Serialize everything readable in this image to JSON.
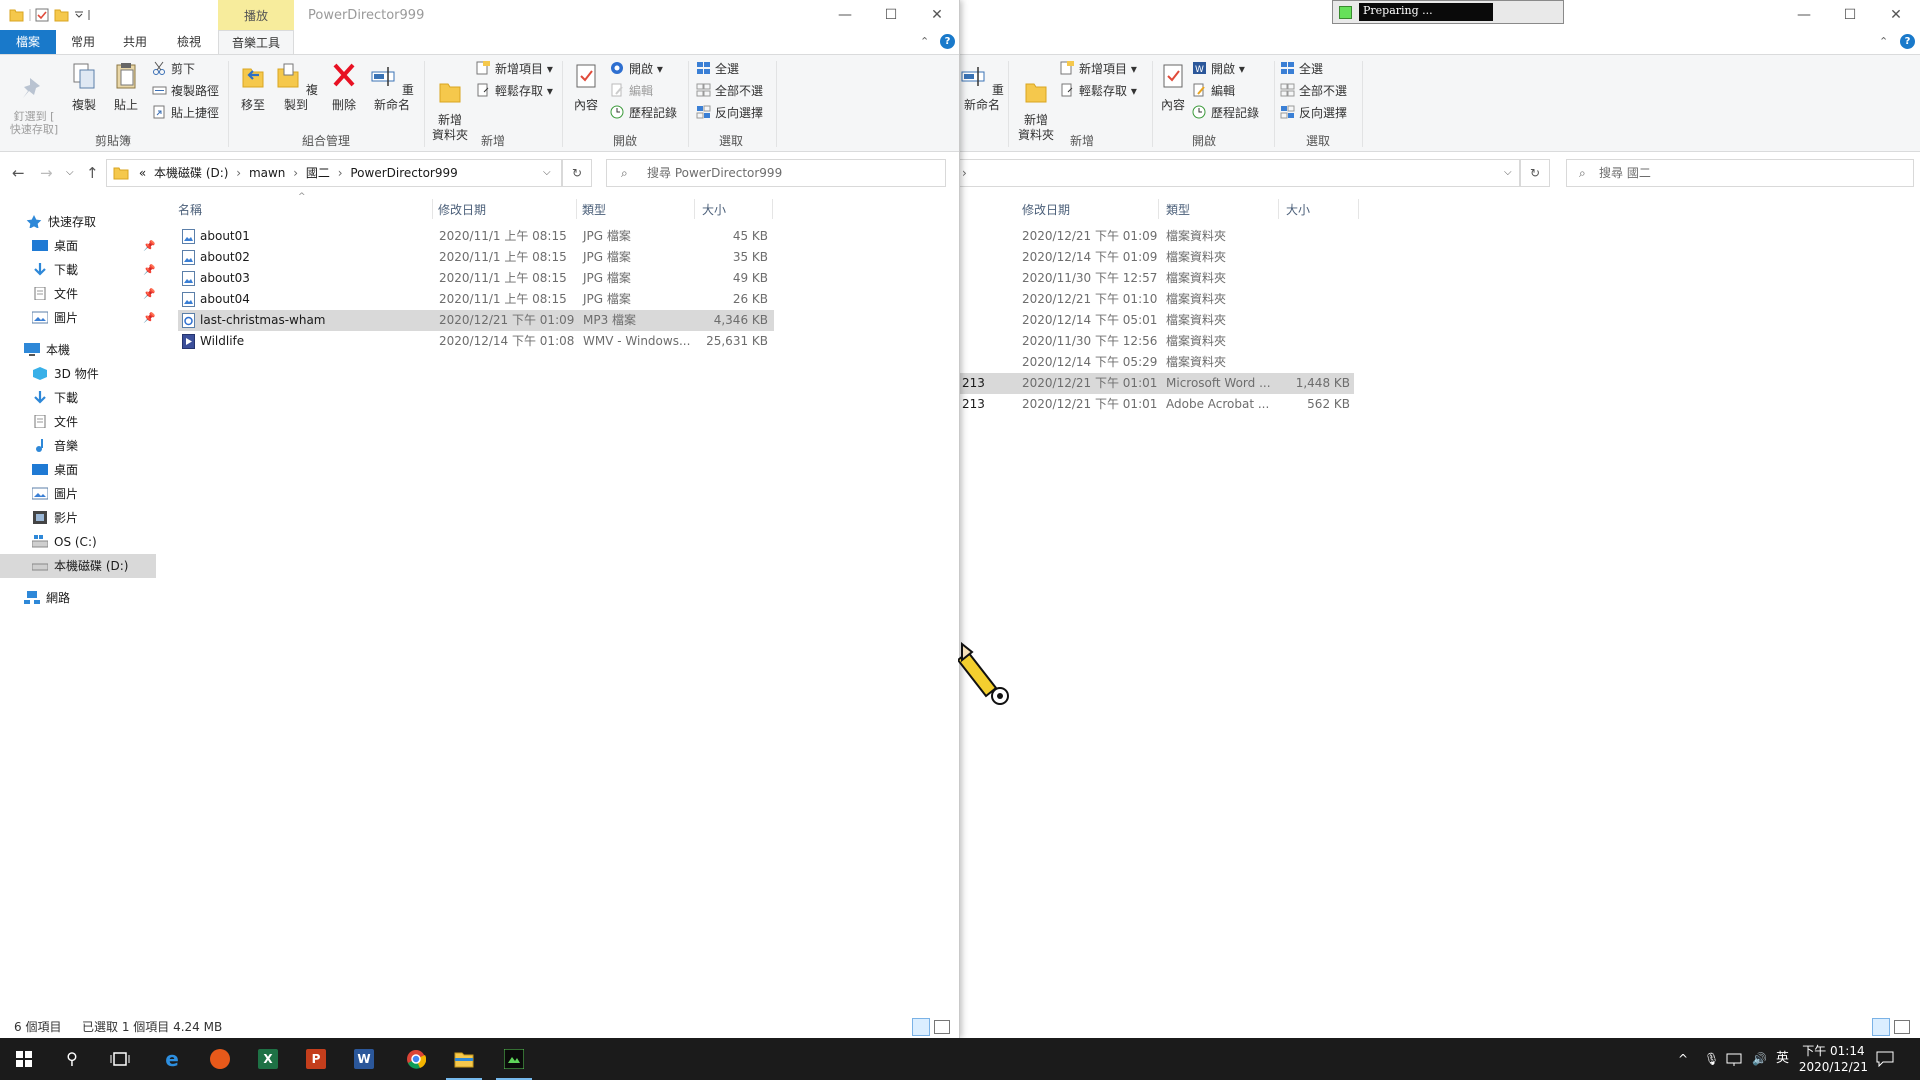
{
  "left_window": {
    "title": "PowerDirector999",
    "context_tab": "播放",
    "tabs": [
      "檔案",
      "常用",
      "共用",
      "檢視",
      "音樂工具"
    ],
    "ribbon": {
      "clipboard": {
        "pin": "釘選到 [\n快速存取]",
        "copy": "複製",
        "paste": "貼上",
        "cut": "剪下",
        "copy_path": "複製路徑",
        "paste_shortcut": "貼上捷徑",
        "group": "剪貼簿"
      },
      "organize": {
        "move_to": "移至",
        "copy_to": "複製到",
        "delete": "刪除",
        "rename": "重新命名",
        "group": "組合管理"
      },
      "new": {
        "new_folder": "新增\n資料夾",
        "new_item": "新增項目 ▾",
        "easy_access": "輕鬆存取 ▾",
        "group": "新增"
      },
      "open": {
        "properties": "內容",
        "open": "開啟 ▾",
        "edit": "編輯",
        "history": "歷程記錄",
        "group": "開啟"
      },
      "select": {
        "select_all": "全選",
        "select_none": "全部不選",
        "invert": "反向選擇",
        "group": "選取"
      }
    },
    "breadcrumb": [
      "«",
      "本機磁碟 (D:)",
      "mawn",
      "國二",
      "PowerDirector999"
    ],
    "search_placeholder": "搜尋 PowerDirector999",
    "nav": {
      "quick_access": "快速存取",
      "qa_items": [
        "桌面",
        "下載",
        "文件",
        "圖片"
      ],
      "this_pc": "本機",
      "pc_items": [
        "3D 物件",
        "下載",
        "文件",
        "音樂",
        "桌面",
        "圖片",
        "影片",
        "OS (C:)",
        "本機磁碟 (D:)"
      ],
      "network": "網路"
    },
    "columns": {
      "name": "名稱",
      "date": "修改日期",
      "type": "類型",
      "size": "大小"
    },
    "files": [
      {
        "name": "about01",
        "date": "2020/11/1 上午 08:15",
        "type": "JPG 檔案",
        "size": "45 KB",
        "icon": "image-file-icon",
        "selected": false
      },
      {
        "name": "about02",
        "date": "2020/11/1 上午 08:15",
        "type": "JPG 檔案",
        "size": "35 KB",
        "icon": "image-file-icon",
        "selected": false
      },
      {
        "name": "about03",
        "date": "2020/11/1 上午 08:15",
        "type": "JPG 檔案",
        "size": "49 KB",
        "icon": "image-file-icon",
        "selected": false
      },
      {
        "name": "about04",
        "date": "2020/11/1 上午 08:15",
        "type": "JPG 檔案",
        "size": "26 KB",
        "icon": "image-file-icon",
        "selected": false
      },
      {
        "name": "last-christmas-wham",
        "date": "2020/12/21 下午 01:09",
        "type": "MP3 檔案",
        "size": "4,346 KB",
        "icon": "audio-file-icon",
        "selected": true
      },
      {
        "name": "Wildlife",
        "date": "2020/12/14 下午 01:08",
        "type": "WMV - Windows...",
        "size": "25,631 KB",
        "icon": "video-file-icon",
        "selected": false
      }
    ],
    "status": {
      "count": "6 個項目",
      "selection": "已選取 1 個項目  4.24 MB"
    }
  },
  "right_window": {
    "ribbon": {
      "rename": "重新命名",
      "new_folder": "新增\n資料夾",
      "new_item": "新增項目 ▾",
      "easy_access": "輕鬆存取 ▾",
      "properties": "內容",
      "open": "開啟 ▾",
      "edit": "編輯",
      "history": "歷程記錄",
      "select_all": "全選",
      "select_none": "全部不選",
      "invert": "反向選擇",
      "group_new": "新增",
      "group_open": "開啟",
      "group_select": "選取"
    },
    "search_placeholder": "搜尋 國二",
    "columns": {
      "date": "修改日期",
      "type": "類型",
      "size": "大小"
    },
    "rows": [
      {
        "prefix": "",
        "date": "2020/12/21 下午 01:09",
        "type": "檔案資料夾",
        "size": "",
        "selected": false
      },
      {
        "prefix": "",
        "date": "2020/12/14 下午 01:09",
        "type": "檔案資料夾",
        "size": "",
        "selected": false
      },
      {
        "prefix": "",
        "date": "2020/11/30 下午 12:57",
        "type": "檔案資料夾",
        "size": "",
        "selected": false
      },
      {
        "prefix": "",
        "date": "2020/12/21 下午 01:10",
        "type": "檔案資料夾",
        "size": "",
        "selected": false
      },
      {
        "prefix": "",
        "date": "2020/12/14 下午 05:01",
        "type": "檔案資料夾",
        "size": "",
        "selected": false
      },
      {
        "prefix": "",
        "date": "2020/11/30 下午 12:56",
        "type": "檔案資料夾",
        "size": "",
        "selected": false
      },
      {
        "prefix": "",
        "date": "2020/12/14 下午 05:29",
        "type": "檔案資料夾",
        "size": "",
        "selected": false
      },
      {
        "prefix": "213",
        "date": "2020/12/21 下午 01:01",
        "type": "Microsoft Word ...",
        "size": "1,448 KB",
        "selected": true
      },
      {
        "prefix": "213",
        "date": "2020/12/21 下午 01:01",
        "type": "Adobe Acrobat ...",
        "size": "562 KB",
        "selected": false
      }
    ]
  },
  "recorder": {
    "label": "Preparing ..."
  },
  "taskbar": {
    "apps": [
      "start-icon",
      "search-icon",
      "task-view-icon",
      "edge-icon",
      "firefox-icon",
      "excel-icon",
      "powerpoint-icon",
      "word-icon",
      "chrome-icon",
      "file-explorer-icon",
      "recorder-app-icon"
    ],
    "ime": "英",
    "time": "下午 01:14",
    "date": "2020/12/21"
  },
  "colors": {
    "accent": "#1979ca",
    "selection": "#d9d9d9",
    "taskbar": "#1b1b1b",
    "context_tab": "#f7ec9c",
    "delete_red": "#e81123"
  }
}
